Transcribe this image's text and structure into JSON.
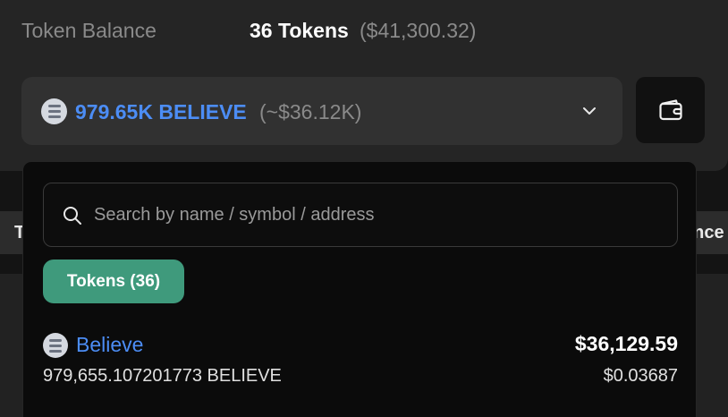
{
  "header": {
    "balance_label": "Token Balance",
    "balance_value": "36 Tokens",
    "balance_usd": "($41,300.32)"
  },
  "token_select": {
    "amount": "979.65K BELIEVE",
    "approx": "(~$36.12K)",
    "icon": "token-logo",
    "chevron": "chevron-down-icon"
  },
  "wallet_button": {
    "icon": "wallet-icon"
  },
  "background": {
    "left_fragment": "T",
    "right_fragment": "ance"
  },
  "dropdown": {
    "search": {
      "placeholder": "Search by name / symbol / address",
      "value": ""
    },
    "tab_label": "Tokens (36)",
    "tokens": [
      {
        "name": "Believe",
        "amount": "979,655.107201773 BELIEVE",
        "value": "$36,129.59",
        "price": "$0.03687"
      }
    ]
  },
  "colors": {
    "accent_blue": "#4c8df5",
    "tab_green": "#3f9a7c",
    "panel_bg": "#0b0b0b"
  }
}
